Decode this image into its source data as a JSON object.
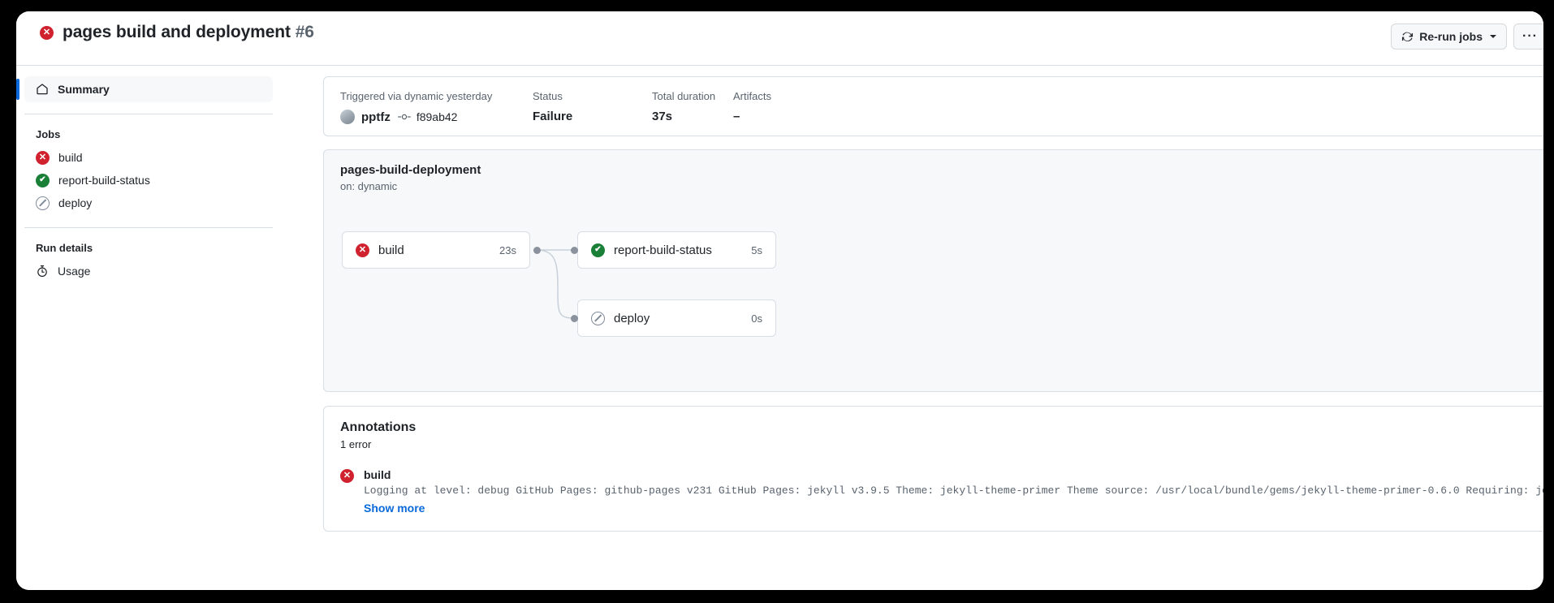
{
  "header": {
    "status_icon": "x-circle-fill-icon",
    "title": "pages build and deployment",
    "run_number": "#6",
    "rerun_label": "Re-run jobs",
    "kebab_label": "···"
  },
  "sidebar": {
    "summary_label": "Summary",
    "jobs_group_label": "Jobs",
    "jobs": [
      {
        "label": "build",
        "status": "failure"
      },
      {
        "label": "report-build-status",
        "status": "success"
      },
      {
        "label": "deploy",
        "status": "skipped"
      }
    ],
    "run_details_group_label": "Run details",
    "usage_label": "Usage"
  },
  "meta": {
    "trigger_label": "Triggered via dynamic yesterday",
    "actor": "pptfz",
    "commit_sha": "f89ab42",
    "status_label": "Status",
    "status_value": "Failure",
    "duration_label": "Total duration",
    "duration_value": "37s",
    "artifacts_label": "Artifacts",
    "artifacts_value": "–"
  },
  "graph": {
    "workflow_name": "pages-build-deployment",
    "trigger": "on: dynamic",
    "nodes": [
      {
        "label": "build",
        "duration": "23s",
        "status": "failure"
      },
      {
        "label": "report-build-status",
        "duration": "5s",
        "status": "success"
      },
      {
        "label": "deploy",
        "duration": "0s",
        "status": "skipped"
      }
    ],
    "tools": {
      "fullscreen": "fullscreen-icon",
      "zoom_out": "−",
      "zoom_in": "+"
    }
  },
  "annotations": {
    "title": "Annotations",
    "count_label": "1 error",
    "items": [
      {
        "job": "build",
        "status": "failure",
        "message": "Logging at level: debug GitHub Pages: github-pages v231 GitHub Pages: jekyll v3.9.5 Theme: jekyll-theme-primer Theme source: /usr/local/bundle/gems/jekyll-theme-primer-0.6.0 Requiring: jekyll-github-met…",
        "show_more_label": "Show more"
      }
    ]
  },
  "colors": {
    "failure": "#cf222e",
    "success": "#1a7f37",
    "skipped": "#818b98",
    "accent": "#0969da"
  }
}
